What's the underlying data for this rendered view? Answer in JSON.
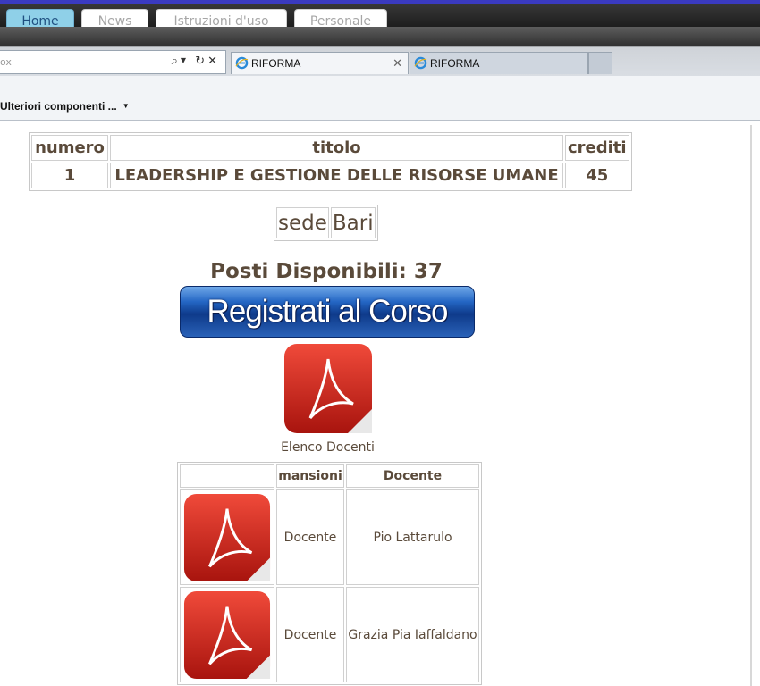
{
  "site_nav": {
    "tabs": [
      "Home",
      "News",
      "Istruzioni d'uso",
      "Personale"
    ]
  },
  "browser": {
    "address_value": "ox",
    "tabs": [
      {
        "label": "RIFORMA",
        "icon": "ie-icon"
      },
      {
        "label": "RIFORMA",
        "icon": "ie-icon"
      }
    ],
    "favorites_item": "Ulteriori componenti ..."
  },
  "course": {
    "headers": [
      "numero",
      "titolo",
      "crediti"
    ],
    "row": {
      "numero": "1",
      "titolo": "LEADERSHIP E GESTIONE DELLE RISORSE UMANE",
      "crediti": "45"
    }
  },
  "sede": {
    "label": "sede",
    "value": "Bari"
  },
  "posti": "Posti Disponibili: 37",
  "register_button": "Registrati al Corso",
  "elenco_docenti": "Elenco Docenti",
  "docenti_table": {
    "headers": [
      "",
      "mansioni",
      "Docente"
    ],
    "rows": [
      {
        "mansione": "Docente",
        "docente": "Pio Lattarulo"
      },
      {
        "mansione": "Docente",
        "docente": "Grazia Pia Iaffaldano"
      }
    ]
  },
  "colors": {
    "text": "#5a4a3a",
    "active_tab": "#8fd0e8",
    "button_blue": "#2466c4",
    "pdf_red": "#d42a1e"
  }
}
